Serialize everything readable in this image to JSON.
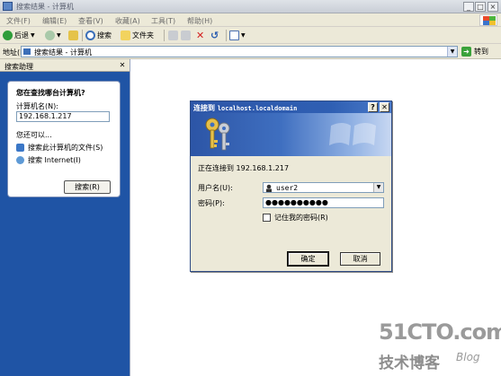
{
  "window": {
    "title": "搜索结果 - 计算机"
  },
  "menu": {
    "items": [
      "文件(F)",
      "编辑(E)",
      "查看(V)",
      "收藏(A)",
      "工具(T)",
      "帮助(H)"
    ]
  },
  "toolbar": {
    "back_label": "后退",
    "search_label": "搜索",
    "folders_label": "文件夹"
  },
  "address": {
    "label": "地址(D)",
    "value": "搜索结果 - 计算机",
    "go_label": "转到"
  },
  "pane": {
    "title": "搜索助理",
    "heading": "您在查找哪台计算机?",
    "name_label": "计算机名(N):",
    "name_value": "192.168.1.217",
    "also_label": "您还可以...",
    "link_files": "搜索此计算机的文件(S)",
    "link_internet": "搜索 Internet(I)",
    "search_button": "搜索(R)"
  },
  "dialog": {
    "title_prefix": "连接到 ",
    "title_host": "localhost.localdomain",
    "connecting_text": "正在连接到 192.168.1.217",
    "user_label": "用户名(U):",
    "user_value": "user2",
    "password_label": "密码(P):",
    "password_value": "●●●●●●●●●●",
    "remember_label": "记住我的密码(R)",
    "ok_label": "确定",
    "cancel_label": "取消"
  },
  "watermark": {
    "main": "51CTO.com",
    "sub": "技术博客",
    "blog": "Blog"
  }
}
